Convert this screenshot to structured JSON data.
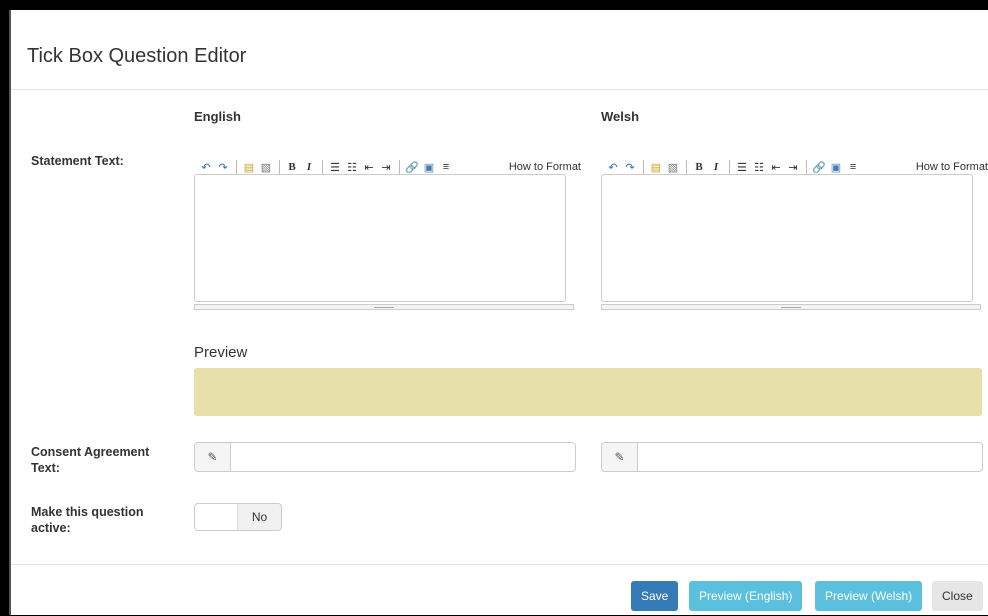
{
  "header": {
    "title": "Tick Box Question Editor"
  },
  "columns": {
    "english": "English",
    "welsh": "Welsh"
  },
  "labels": {
    "statement": "Statement Text:",
    "consent_line1": "Consent Agreement",
    "consent_line2": "Text:",
    "active_line1": "Make this question",
    "active_line2": "active:"
  },
  "toolbar": {
    "undo": "↶",
    "redo": "↷",
    "bold": "B",
    "italic": "I",
    "ul": "☰",
    "ol": "☷",
    "outdent": "⇤",
    "indent": "⇥",
    "link": "🔗",
    "image": "▣",
    "hr": "≡",
    "doc1": "▤",
    "doc2": "▧",
    "how_to_format": "How to Format"
  },
  "preview": {
    "label": "Preview"
  },
  "consent": {
    "english_value": "",
    "welsh_value": "",
    "addon_icon": "pencil-icon",
    "addon_glyph": "✎"
  },
  "toggle": {
    "label": "No"
  },
  "footer": {
    "save": "Save",
    "preview_english": "Preview (English)",
    "preview_welsh": "Preview (Welsh)",
    "close": "Close"
  },
  "colors": {
    "primary": "#337ab7",
    "info": "#5bc0de",
    "preview_bg": "#e8e0aa"
  }
}
